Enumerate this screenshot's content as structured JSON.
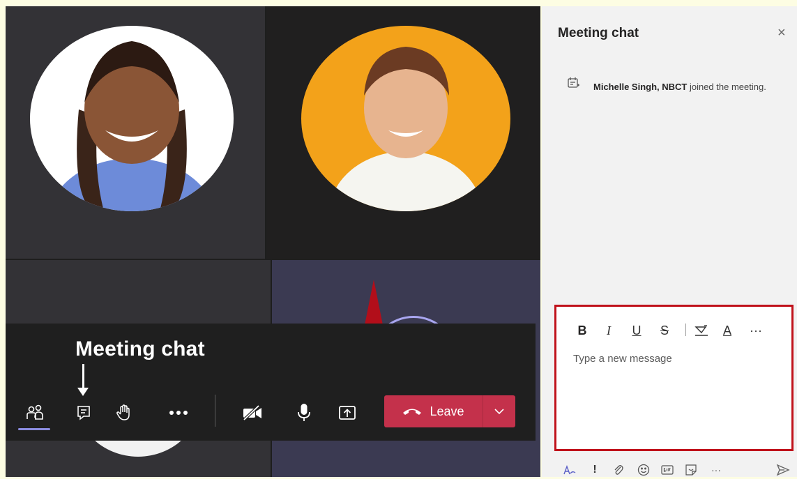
{
  "toolbar": {
    "callout_label": "Meeting chat",
    "leave_label": "Leave",
    "buttons": [
      "participants-icon",
      "chat-icon",
      "raise-hand-icon",
      "more-icon",
      "camera-off-icon",
      "mic-icon",
      "share-icon"
    ]
  },
  "chat_panel": {
    "title": "Meeting chat",
    "close_glyph": "×",
    "system_message": {
      "name": "Michelle Singh, NBCT",
      "text": " joined the meeting."
    },
    "composer": {
      "placeholder": "Type a new message",
      "format": {
        "bold": "B",
        "italic": "I",
        "underline": "U",
        "strike": "S",
        "font_color": "A",
        "more": "···"
      }
    },
    "bottom_more": "···"
  },
  "colors": {
    "leave_red": "#c4314b",
    "highlight_border": "#c0121b",
    "active_underline": "#8b8cdf"
  }
}
